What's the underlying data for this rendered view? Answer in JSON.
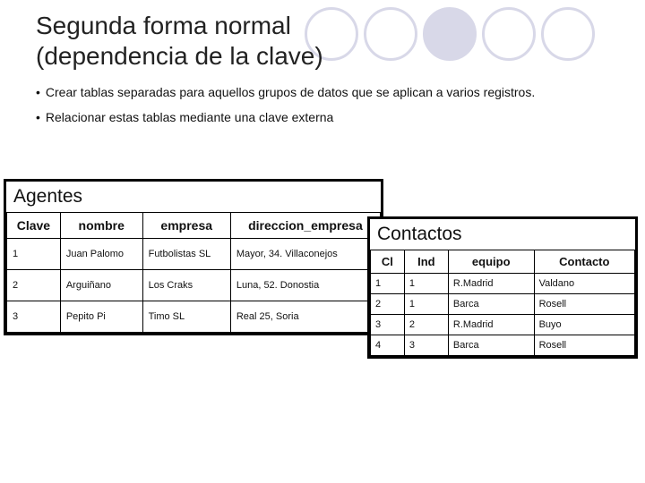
{
  "title_line1": "Segunda forma normal",
  "title_line2": "(dependencia de la clave)",
  "bullets": [
    "Crear tablas separadas para aquellos grupos de datos que se aplican a varios registros.",
    "Relacionar estas tablas mediante una clave externa"
  ],
  "agentes": {
    "title": "Agentes",
    "headers": [
      "Clave",
      "nombre",
      "empresa",
      "direccion_empresa"
    ],
    "rows": [
      [
        "1",
        "Juan Palomo",
        "Futbolistas SL",
        "Mayor, 34. Villaconejos"
      ],
      [
        "2",
        "Arguiñano",
        "Los Craks",
        "Luna, 52. Donostia"
      ],
      [
        "3",
        "Pepito Pi",
        "Timo SL",
        "Real 25, Soria"
      ]
    ]
  },
  "contactos": {
    "title": "Contactos",
    "headers": [
      "Cl",
      "Ind",
      "equipo",
      "Contacto"
    ],
    "rows": [
      [
        "1",
        "1",
        "R.Madrid",
        "Valdano"
      ],
      [
        "2",
        "1",
        "Barca",
        "Rosell"
      ],
      [
        "3",
        "2",
        "R.Madrid",
        "Buyo"
      ],
      [
        "4",
        "3",
        "Barca",
        "Rosell"
      ]
    ]
  }
}
